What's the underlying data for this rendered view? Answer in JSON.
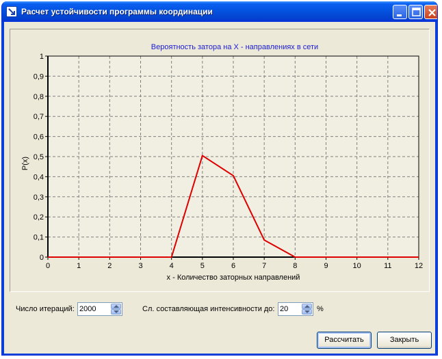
{
  "window": {
    "title": "Расчет устойчивости программы координации",
    "minimize_icon": "minimize-icon",
    "maximize_icon": "maximize-icon",
    "close_icon": "close-icon"
  },
  "chart_data": {
    "type": "line",
    "title": "Вероятность затора на X - направлениях в сети",
    "xlabel": "x - Количество заторных направлений",
    "ylabel": "P(x)",
    "xlim": [
      0,
      12
    ],
    "ylim": [
      0,
      1
    ],
    "x_ticks": [
      "0",
      "1",
      "2",
      "3",
      "4",
      "5",
      "6",
      "7",
      "8",
      "9",
      "10",
      "11",
      "12"
    ],
    "y_ticks": [
      "0",
      "0,1",
      "0,2",
      "0,3",
      "0,4",
      "0,5",
      "0,6",
      "0,7",
      "0,8",
      "0,9",
      "1"
    ],
    "grid": true,
    "series": [
      {
        "color": "#dd0000",
        "x": [
          0,
          1,
          2,
          3,
          4,
          5,
          6,
          7,
          8,
          9,
          10,
          11,
          12
        ],
        "y": [
          0,
          0,
          0,
          0,
          0,
          0.505,
          0.405,
          0.085,
          0,
          0,
          0,
          0,
          0
        ]
      }
    ],
    "colors": {
      "plot_bg": "#f1efe2",
      "grid": "#808080",
      "title": "#1a1ad6"
    }
  },
  "controls": {
    "iterations_label": "Число итераций:",
    "iterations_value": "2000",
    "intensity_label": "Сл. составляющая интенсивности до:",
    "intensity_value": "20",
    "percent_label": "%"
  },
  "buttons": {
    "calculate": "Рассчитать",
    "close": "Закрыть"
  }
}
